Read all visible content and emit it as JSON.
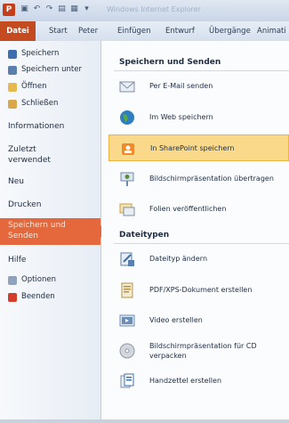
{
  "quick_access": {
    "app_icon": "P",
    "buttons": [
      "save-icon",
      "undo-icon",
      "redo-icon",
      "open-icon",
      "print-icon",
      "dropdown-icon"
    ],
    "window_title": "Windows Internet Explorer"
  },
  "ribbon": {
    "tabs": [
      "Datei",
      "Start",
      "Peter",
      "Einfügen",
      "Entwurf",
      "Übergänge",
      "Animati"
    ]
  },
  "sidebar": {
    "items": [
      {
        "label": "Speichern",
        "icon": "save-icon"
      },
      {
        "label": "Speichern unter",
        "icon": "save-as-icon"
      },
      {
        "label": "Öffnen",
        "icon": "open-folder-icon"
      },
      {
        "label": "Schließen",
        "icon": "close-folder-icon"
      }
    ],
    "categories": [
      "Informationen",
      "Zuletzt verwendet",
      "Neu",
      "Drucken"
    ],
    "active": "Speichern und Senden",
    "hilfe": "Hilfe",
    "bottom_items": [
      {
        "label": "Optionen",
        "icon": "options-icon"
      },
      {
        "label": "Beenden",
        "icon": "exit-icon"
      }
    ]
  },
  "content": {
    "section1": "Speichern und Senden",
    "options1": [
      {
        "label": "Per E-Mail senden",
        "icon": "email-icon",
        "color": "#cfd8e6"
      },
      {
        "label": "Im Web speichern",
        "icon": "globe-icon",
        "color": "#2f7fbf"
      },
      {
        "label": "In SharePoint speichern",
        "icon": "sharepoint-icon",
        "color": "#f08a2b"
      },
      {
        "label": "Bildschirmpräsentation übertragen",
        "icon": "broadcast-icon",
        "color": "#5c8b3b"
      },
      {
        "label": "Folien veröffentlichen",
        "icon": "publish-slides-icon",
        "color": "#e6b84d"
      }
    ],
    "section2": "Dateitypen",
    "options2": [
      {
        "label": "Dateityp ändern",
        "icon": "change-file-type-icon",
        "color": "#5a7fae"
      },
      {
        "label": "PDF/XPS-Dokument erstellen",
        "icon": "pdf-icon",
        "color": "#d9a84a"
      },
      {
        "label": "Video erstellen",
        "icon": "video-icon",
        "color": "#6e8db5"
      },
      {
        "label": "Bildschirmpräsentation für CD verpacken",
        "icon": "cd-icon",
        "color": "#a8b0bb"
      },
      {
        "label": "Handzettel erstellen",
        "icon": "handouts-icon",
        "color": "#3d6fb0"
      }
    ]
  },
  "colors": {
    "accent": "#c44a1f",
    "selected_sidebar": "#e4683c",
    "selected_option": "#fbd98a"
  }
}
